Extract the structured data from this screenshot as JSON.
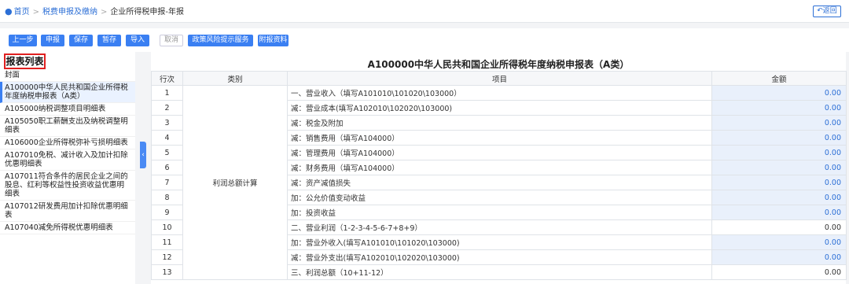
{
  "breadcrumb": {
    "home": "首页",
    "level2": "税费申报及缴纳",
    "current": "企业所得税申报-年报"
  },
  "back_label": "返回",
  "toolbar": {
    "prev": "上一步",
    "declare": "申报",
    "save": "保存",
    "temp_save": "暂存",
    "import": "导入",
    "cancel": "取消",
    "risk": "政策风险提示服务",
    "attach": "附报资料"
  },
  "left_panel": {
    "title": "报表列表",
    "items": [
      {
        "label": "封面"
      },
      {
        "label": "A100000中华人民共和国企业所得税年度纳税申报表（A类）"
      },
      {
        "label": "A105000纳税调整项目明细表"
      },
      {
        "label": "A105050职工薪酬支出及纳税调整明细表"
      },
      {
        "label": "A106000企业所得税弥补亏损明细表"
      },
      {
        "label": "A107010免税、减计收入及加计扣除优惠明细表"
      },
      {
        "label": "A107011符合条件的居民企业之间的股息、红利等权益性投资收益优惠明细表"
      },
      {
        "label": "A107012研发费用加计扣除优惠明细表"
      },
      {
        "label": "A107040减免所得税优惠明细表"
      }
    ]
  },
  "table": {
    "title": "A100000中华人民共和国企业所得税年度纳税申报表（A类）",
    "headers": {
      "no": "行次",
      "category": "类别",
      "item": "项目",
      "amount": "金额"
    },
    "category_label": "利润总额计算",
    "rows": [
      {
        "no": "1",
        "item": "一、营业收入（填写A101010\\101020\\103000）",
        "amount": "0.00"
      },
      {
        "no": "2",
        "item": "减：营业成本(填写A102010\\102020\\103000)",
        "amount": "0.00"
      },
      {
        "no": "3",
        "item": "减：税金及附加",
        "amount": "0.00"
      },
      {
        "no": "4",
        "item": "减：销售费用（填写A104000）",
        "amount": "0.00"
      },
      {
        "no": "5",
        "item": "减：管理费用（填写A104000）",
        "amount": "0.00"
      },
      {
        "no": "6",
        "item": "减：财务费用（填写A104000）",
        "amount": "0.00"
      },
      {
        "no": "7",
        "item": "减：资产减值损失",
        "amount": "0.00"
      },
      {
        "no": "8",
        "item": "加：公允价值变动收益",
        "amount": "0.00"
      },
      {
        "no": "9",
        "item": "加：投资收益",
        "amount": "0.00"
      },
      {
        "no": "10",
        "item": "二、营业利润（1-2-3-4-5-6-7+8+9）",
        "amount": "0.00"
      },
      {
        "no": "11",
        "item": "加：营业外收入(填写A101010\\101020\\103000)",
        "amount": "0.00"
      },
      {
        "no": "12",
        "item": "减：营业外支出(填写A102010\\102020\\103000)",
        "amount": "0.00"
      },
      {
        "no": "13",
        "item": "三、利润总额（10+11-12）",
        "amount": "0.00"
      }
    ]
  },
  "colors": {
    "accent": "#3a7ff2",
    "highlight": "#e02020",
    "input_bg": "#e9f0fb"
  }
}
